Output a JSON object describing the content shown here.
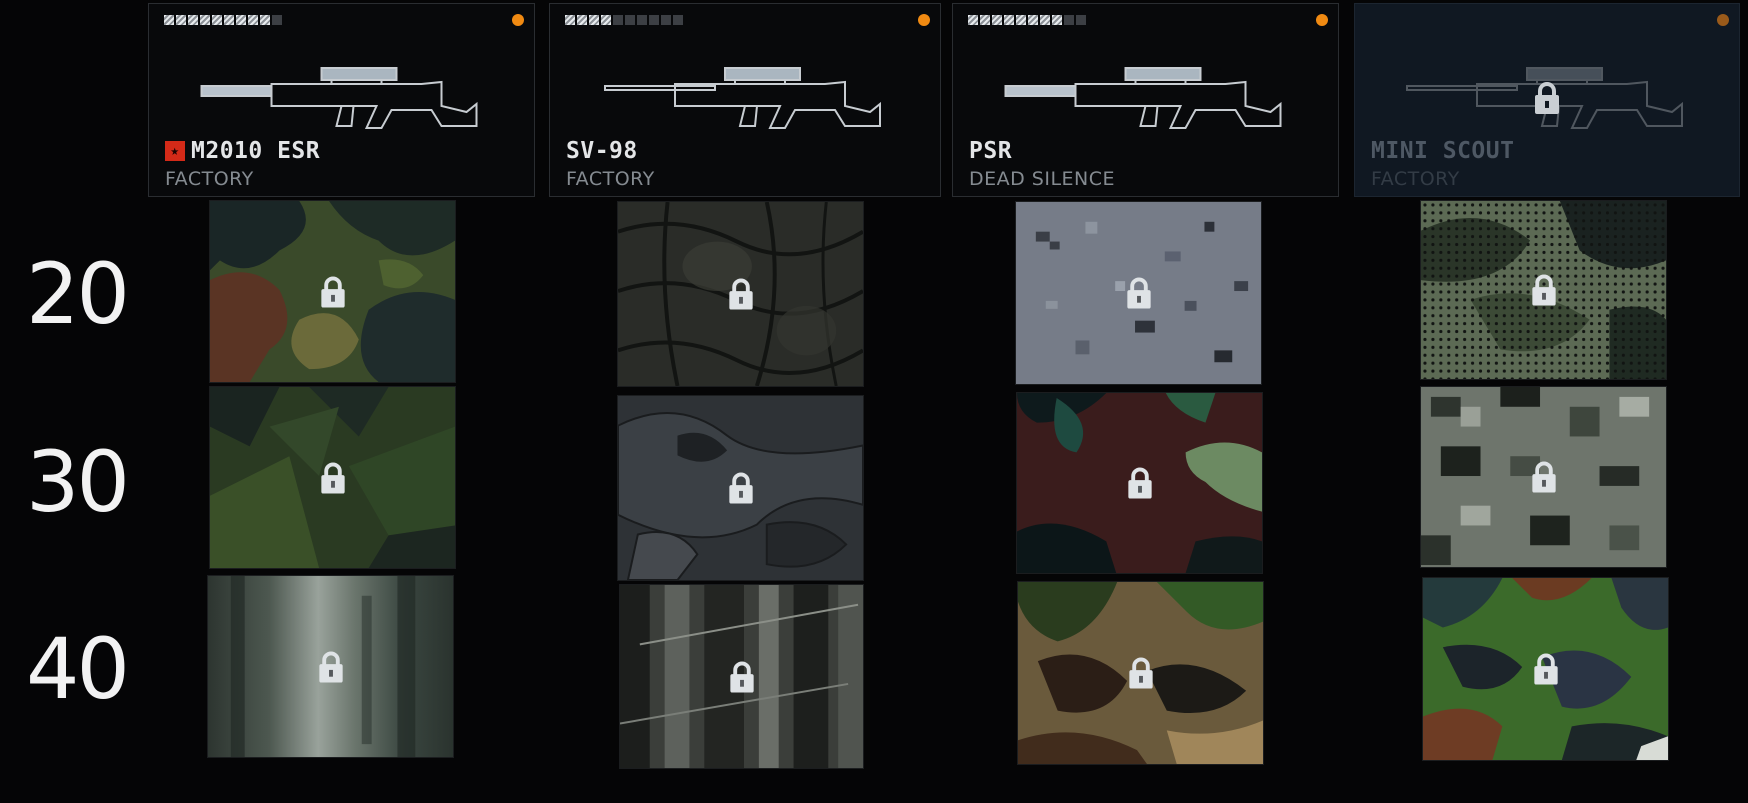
{
  "weapons": [
    {
      "name": "M2010 ESR",
      "variant": "FACTORY",
      "progress_filled": 9,
      "progress_total": 10,
      "has_rank_badge": true,
      "locked": false,
      "notification_color": "#f08a12"
    },
    {
      "name": "SV-98",
      "variant": "FACTORY",
      "progress_filled": 4,
      "progress_total": 10,
      "has_rank_badge": false,
      "locked": false,
      "notification_color": "#f08a12"
    },
    {
      "name": "PSR",
      "variant": "DEAD SILENCE",
      "progress_filled": 8,
      "progress_total": 10,
      "has_rank_badge": false,
      "locked": false,
      "notification_color": "#f08a12"
    },
    {
      "name": "MINI SCOUT",
      "variant": "FACTORY",
      "progress_filled": 0,
      "progress_total": 0,
      "has_rank_badge": false,
      "locked": true,
      "notification_color": "#f08a12"
    }
  ],
  "levels": [
    "20",
    "30",
    "40"
  ],
  "camo_icon": "lock-icon",
  "accent_colors": {
    "notification": "#f08a12",
    "rank_badge": "#d42a18"
  }
}
